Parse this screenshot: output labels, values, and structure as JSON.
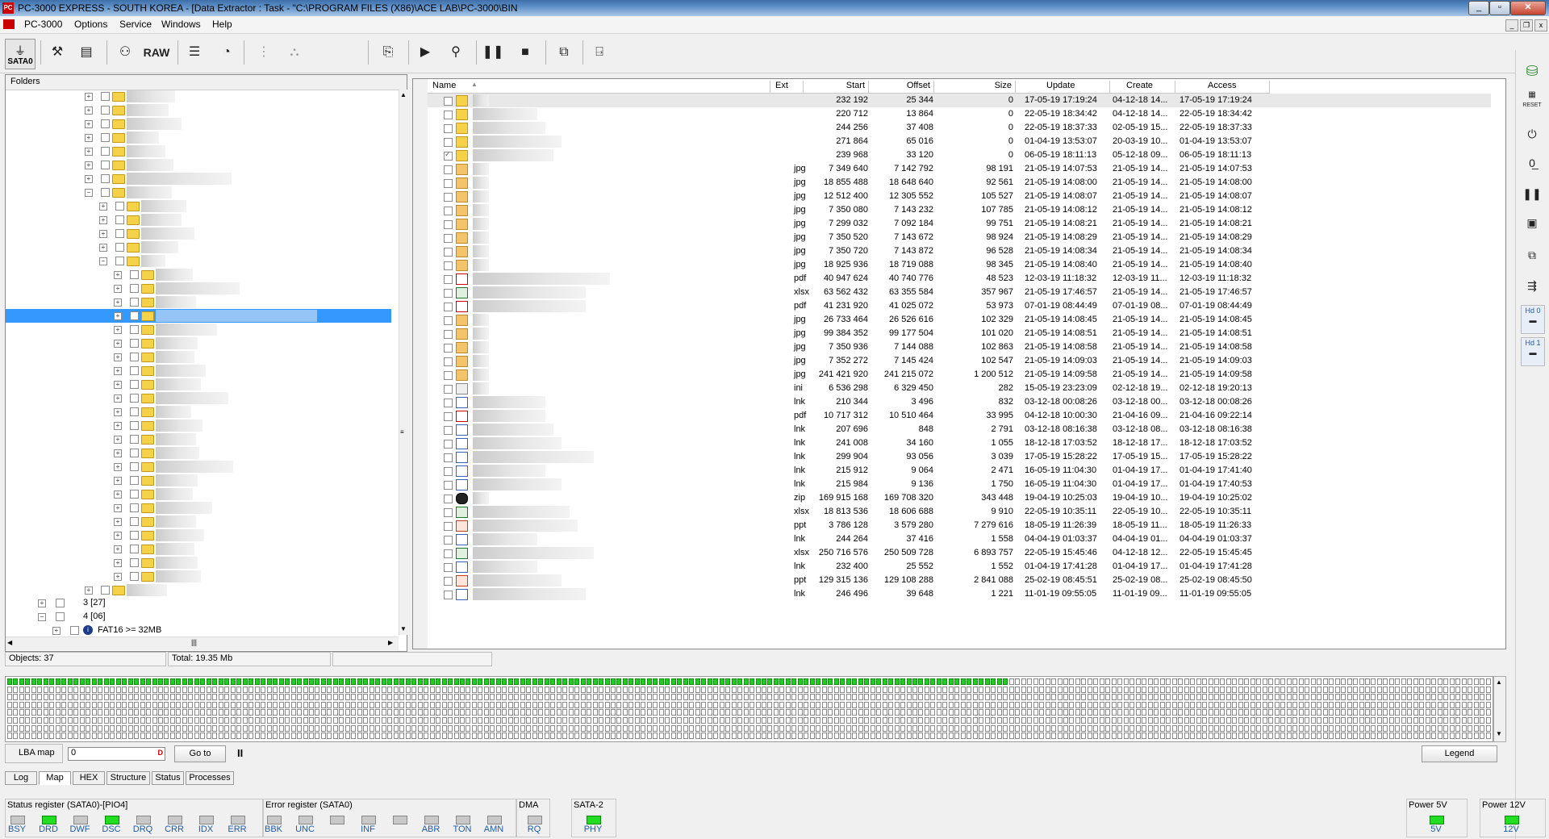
{
  "window": {
    "title": "PC-3000 EXPRESS - SOUTH KOREA - [Data Extractor : Task - \"C:\\PROGRAM FILES (X86)\\ACE LAB\\PC-3000\\BIN"
  },
  "menu": [
    "PC-3000",
    "Options",
    "Service",
    "Windows",
    "Help"
  ],
  "toolbar": {
    "sata_label": "SATA0",
    "raw_label": "RAW"
  },
  "folders_panel": {
    "header": "Folders",
    "partitions": [
      {
        "label": "3 [27]"
      },
      {
        "label": "4 [06]"
      },
      {
        "label": "FAT16 >=   32MB"
      }
    ]
  },
  "files_panel": {
    "columns": [
      "Name",
      "Ext",
      "Start",
      "Offset",
      "Size",
      "Update",
      "Create",
      "Access"
    ],
    "rows": [
      {
        "icon": "folder",
        "ext": "",
        "start": "232 192",
        "offset": "25 344",
        "size": "0",
        "update": "17-05-19 17:19:24",
        "create": "04-12-18 14...",
        "access": "17-05-19 17:19:24",
        "checked": false
      },
      {
        "icon": "folder",
        "ext": "",
        "start": "220 712",
        "offset": "13 864",
        "size": "0",
        "update": "22-05-19 18:34:42",
        "create": "04-12-18 14...",
        "access": "22-05-19 18:34:42",
        "checked": false
      },
      {
        "icon": "folder",
        "ext": "",
        "start": "244 256",
        "offset": "37 408",
        "size": "0",
        "update": "22-05-19 18:37:33",
        "create": "02-05-19 15...",
        "access": "22-05-19 18:37:33",
        "checked": false
      },
      {
        "icon": "folder",
        "ext": "",
        "start": "271 864",
        "offset": "65 016",
        "size": "0",
        "update": "01-04-19 13:53:07",
        "create": "20-03-19 10...",
        "access": "01-04-19 13:53:07",
        "checked": false
      },
      {
        "icon": "folder",
        "ext": "",
        "start": "239 968",
        "offset": "33 120",
        "size": "0",
        "update": "06-05-19 18:11:13",
        "create": "05-12-18 09...",
        "access": "06-05-19 18:11:13",
        "checked": true
      },
      {
        "icon": "jpg",
        "ext": "jpg",
        "start": "7 349 640",
        "offset": "7 142 792",
        "size": "98 191",
        "update": "21-05-19 14:07:53",
        "create": "21-05-19 14...",
        "access": "21-05-19 14:07:53",
        "checked": false
      },
      {
        "icon": "jpg",
        "ext": "jpg",
        "start": "18 855 488",
        "offset": "18 648 640",
        "size": "92 561",
        "update": "21-05-19 14:08:00",
        "create": "21-05-19 14...",
        "access": "21-05-19 14:08:00",
        "checked": false
      },
      {
        "icon": "jpg",
        "ext": "jpg",
        "start": "12 512 400",
        "offset": "12 305 552",
        "size": "105 527",
        "update": "21-05-19 14:08:07",
        "create": "21-05-19 14...",
        "access": "21-05-19 14:08:07",
        "checked": false
      },
      {
        "icon": "jpg",
        "ext": "jpg",
        "start": "7 350 080",
        "offset": "7 143 232",
        "size": "107 785",
        "update": "21-05-19 14:08:12",
        "create": "21-05-19 14...",
        "access": "21-05-19 14:08:12",
        "checked": false
      },
      {
        "icon": "jpg",
        "ext": "jpg",
        "start": "7 299 032",
        "offset": "7 092 184",
        "size": "99 751",
        "update": "21-05-19 14:08:21",
        "create": "21-05-19 14...",
        "access": "21-05-19 14:08:21",
        "checked": false
      },
      {
        "icon": "jpg",
        "ext": "jpg",
        "start": "7 350 520",
        "offset": "7 143 672",
        "size": "98 924",
        "update": "21-05-19 14:08:29",
        "create": "21-05-19 14...",
        "access": "21-05-19 14:08:29",
        "checked": false
      },
      {
        "icon": "jpg",
        "ext": "jpg",
        "start": "7 350 720",
        "offset": "7 143 872",
        "size": "96 528",
        "update": "21-05-19 14:08:34",
        "create": "21-05-19 14...",
        "access": "21-05-19 14:08:34",
        "checked": false
      },
      {
        "icon": "jpg",
        "ext": "jpg",
        "start": "18 925 936",
        "offset": "18 719 088",
        "size": "98 345",
        "update": "21-05-19 14:08:40",
        "create": "21-05-19 14...",
        "access": "21-05-19 14:08:40",
        "checked": false
      },
      {
        "icon": "pdf",
        "ext": "pdf",
        "start": "40 947 624",
        "offset": "40 740 776",
        "size": "48 523",
        "update": "12-03-19 11:18:32",
        "create": "12-03-19 11...",
        "access": "12-03-19 11:18:32",
        "checked": false
      },
      {
        "icon": "xlsx",
        "ext": "xlsx",
        "start": "63 562 432",
        "offset": "63 355 584",
        "size": "357 967",
        "update": "21-05-19 17:46:57",
        "create": "21-05-19 14...",
        "access": "21-05-19 17:46:57",
        "checked": false
      },
      {
        "icon": "pdf",
        "ext": "pdf",
        "start": "41 231 920",
        "offset": "41 025 072",
        "size": "53 973",
        "update": "07-01-19 08:44:49",
        "create": "07-01-19 08...",
        "access": "07-01-19 08:44:49",
        "checked": false
      },
      {
        "icon": "jpg",
        "ext": "jpg",
        "start": "26 733 464",
        "offset": "26 526 616",
        "size": "102 329",
        "update": "21-05-19 14:08:45",
        "create": "21-05-19 14...",
        "access": "21-05-19 14:08:45",
        "checked": false
      },
      {
        "icon": "jpg",
        "ext": "jpg",
        "start": "99 384 352",
        "offset": "99 177 504",
        "size": "101 020",
        "update": "21-05-19 14:08:51",
        "create": "21-05-19 14...",
        "access": "21-05-19 14:08:51",
        "checked": false
      },
      {
        "icon": "jpg",
        "ext": "jpg",
        "start": "7 350 936",
        "offset": "7 144 088",
        "size": "102 863",
        "update": "21-05-19 14:08:58",
        "create": "21-05-19 14...",
        "access": "21-05-19 14:08:58",
        "checked": false
      },
      {
        "icon": "jpg",
        "ext": "jpg",
        "start": "7 352 272",
        "offset": "7 145 424",
        "size": "102 547",
        "update": "21-05-19 14:09:03",
        "create": "21-05-19 14...",
        "access": "21-05-19 14:09:03",
        "checked": false
      },
      {
        "icon": "jpg",
        "ext": "jpg",
        "start": "241 421 920",
        "offset": "241 215 072",
        "size": "1 200 512",
        "update": "21-05-19 14:09:58",
        "create": "21-05-19 14...",
        "access": "21-05-19 14:09:58",
        "checked": false
      },
      {
        "icon": "ini",
        "ext": "ini",
        "start": "6 536 298",
        "offset": "6 329 450",
        "size": "282",
        "update": "15-05-19 23:23:09",
        "create": "02-12-18 19...",
        "access": "02-12-18 19:20:13",
        "checked": false
      },
      {
        "icon": "lnk",
        "ext": "lnk",
        "start": "210 344",
        "offset": "3 496",
        "size": "832",
        "update": "03-12-18 00:08:26",
        "create": "03-12-18 00...",
        "access": "03-12-18 00:08:26",
        "checked": false
      },
      {
        "icon": "pdf",
        "ext": "pdf",
        "start": "10 717 312",
        "offset": "10 510 464",
        "size": "33 995",
        "update": "04-12-18 10:00:30",
        "create": "21-04-16 09...",
        "access": "21-04-16 09:22:14",
        "checked": false
      },
      {
        "icon": "lnk",
        "ext": "lnk",
        "start": "207 696",
        "offset": "848",
        "size": "2 791",
        "update": "03-12-18 08:16:38",
        "create": "03-12-18 08...",
        "access": "03-12-18 08:16:38",
        "checked": false
      },
      {
        "icon": "lnk",
        "ext": "lnk",
        "start": "241 008",
        "offset": "34 160",
        "size": "1 055",
        "update": "18-12-18 17:03:52",
        "create": "18-12-18 17...",
        "access": "18-12-18 17:03:52",
        "checked": false
      },
      {
        "icon": "lnk",
        "ext": "lnk",
        "start": "299 904",
        "offset": "93 056",
        "size": "3 039",
        "update": "17-05-19 15:28:22",
        "create": "17-05-19 15...",
        "access": "17-05-19 15:28:22",
        "checked": false
      },
      {
        "icon": "lnk",
        "ext": "lnk",
        "start": "215 912",
        "offset": "9 064",
        "size": "2 471",
        "update": "16-05-19 11:04:30",
        "create": "01-04-19 17...",
        "access": "01-04-19 17:41:40",
        "checked": false
      },
      {
        "icon": "lnk",
        "ext": "lnk",
        "start": "215 984",
        "offset": "9 136",
        "size": "1 750",
        "update": "16-05-19 11:04:30",
        "create": "01-04-19 17...",
        "access": "01-04-19 17:40:53",
        "checked": false
      },
      {
        "icon": "zip",
        "ext": "zip",
        "start": "169 915 168",
        "offset": "169 708 320",
        "size": "343 448",
        "update": "19-04-19 10:25:03",
        "create": "19-04-19 10...",
        "access": "19-04-19 10:25:02",
        "checked": false
      },
      {
        "icon": "xlsx",
        "ext": "xlsx",
        "start": "18 813 536",
        "offset": "18 606 688",
        "size": "9 910",
        "update": "22-05-19 10:35:11",
        "create": "22-05-19 10...",
        "access": "22-05-19 10:35:11",
        "checked": false
      },
      {
        "icon": "ppt",
        "ext": "ppt",
        "start": "3 786 128",
        "offset": "3 579 280",
        "size": "7 279 616",
        "update": "18-05-19 11:26:39",
        "create": "18-05-19 11...",
        "access": "18-05-19 11:26:33",
        "checked": false
      },
      {
        "icon": "lnk",
        "ext": "lnk",
        "start": "244 264",
        "offset": "37 416",
        "size": "1 558",
        "update": "04-04-19 01:03:37",
        "create": "04-04-19 01...",
        "access": "04-04-19 01:03:37",
        "checked": false
      },
      {
        "icon": "xlsx",
        "ext": "xlsx",
        "start": "250 716 576",
        "offset": "250 509 728",
        "size": "6 893 757",
        "update": "22-05-19 15:45:46",
        "create": "04-12-18 12...",
        "access": "22-05-19 15:45:45",
        "checked": false
      },
      {
        "icon": "lnk",
        "ext": "lnk",
        "start": "232 400",
        "offset": "25 552",
        "size": "1 552",
        "update": "01-04-19 17:41:28",
        "create": "01-04-19 17...",
        "access": "01-04-19 17:41:28",
        "checked": false
      },
      {
        "icon": "ppt",
        "ext": "ppt",
        "start": "129 315 136",
        "offset": "129 108 288",
        "size": "2 841 088",
        "update": "25-02-19 08:45:51",
        "create": "25-02-19 08...",
        "access": "25-02-19 08:45:50",
        "checked": false
      },
      {
        "icon": "lnk",
        "ext": "lnk",
        "start": "246 496",
        "offset": "39 648",
        "size": "1 221",
        "update": "11-01-19 09:55:05",
        "create": "11-01-19 09...",
        "access": "11-01-19 09:55:05",
        "checked": false
      }
    ]
  },
  "status": {
    "objects": "Objects: 37",
    "total": "Total: 19.35 Mb"
  },
  "map": {
    "filled_fraction": 0.675,
    "filled_color": "#22cc22",
    "empty_color": "#ffffff"
  },
  "lba": {
    "label": "LBA map",
    "input_value": "0",
    "dec_label": "D",
    "goto_label": "Go to",
    "pause_label": "II",
    "legend_label": "Legend"
  },
  "tabs": [
    {
      "label": "Log",
      "active": false
    },
    {
      "label": "Map",
      "active": true
    },
    {
      "label": "HEX",
      "active": false
    },
    {
      "label": "Structure",
      "active": false
    },
    {
      "label": "Status",
      "active": false
    },
    {
      "label": "Processes",
      "active": false
    }
  ],
  "registers": {
    "status_title": "Status register (SATA0)-[PIO4]",
    "status_bits": [
      {
        "name": "BSY",
        "on": false
      },
      {
        "name": "DRD",
        "on": true
      },
      {
        "name": "DWF",
        "on": false
      },
      {
        "name": "DSC",
        "on": true
      },
      {
        "name": "DRQ",
        "on": false
      },
      {
        "name": "CRR",
        "on": false
      },
      {
        "name": "IDX",
        "on": false
      },
      {
        "name": "ERR",
        "on": false
      }
    ],
    "error_title": "Error register (SATA0)",
    "error_bits": [
      {
        "name": "BBK",
        "on": false
      },
      {
        "name": "UNC",
        "on": false
      },
      {
        "name": "",
        "on": false
      },
      {
        "name": "INF",
        "on": false
      },
      {
        "name": "",
        "on": false
      },
      {
        "name": "ABR",
        "on": false
      },
      {
        "name": "TON",
        "on": false
      },
      {
        "name": "AMN",
        "on": false
      }
    ],
    "dma_title": "DMA",
    "dma_bits": [
      {
        "name": "RQ",
        "on": false
      }
    ],
    "sata_title": "SATA-2",
    "sata_bits": [
      {
        "name": "PHY",
        "on": true
      }
    ],
    "power5_title": "Power 5V",
    "power5_bits": [
      {
        "name": "5V",
        "on": true
      }
    ],
    "power12_title": "Power 12V",
    "power12_bits": [
      {
        "name": "12V",
        "on": true
      }
    ]
  },
  "colors": {
    "selection": "#3399ff",
    "led_on": "#22dd22",
    "led_off": "#c8c8c8",
    "reg_label": "#1e5aa8"
  },
  "right_toolbar": {
    "hd0_label": "Hd 0",
    "hd1_label": "Hd 1",
    "reset_label": "RESET"
  }
}
